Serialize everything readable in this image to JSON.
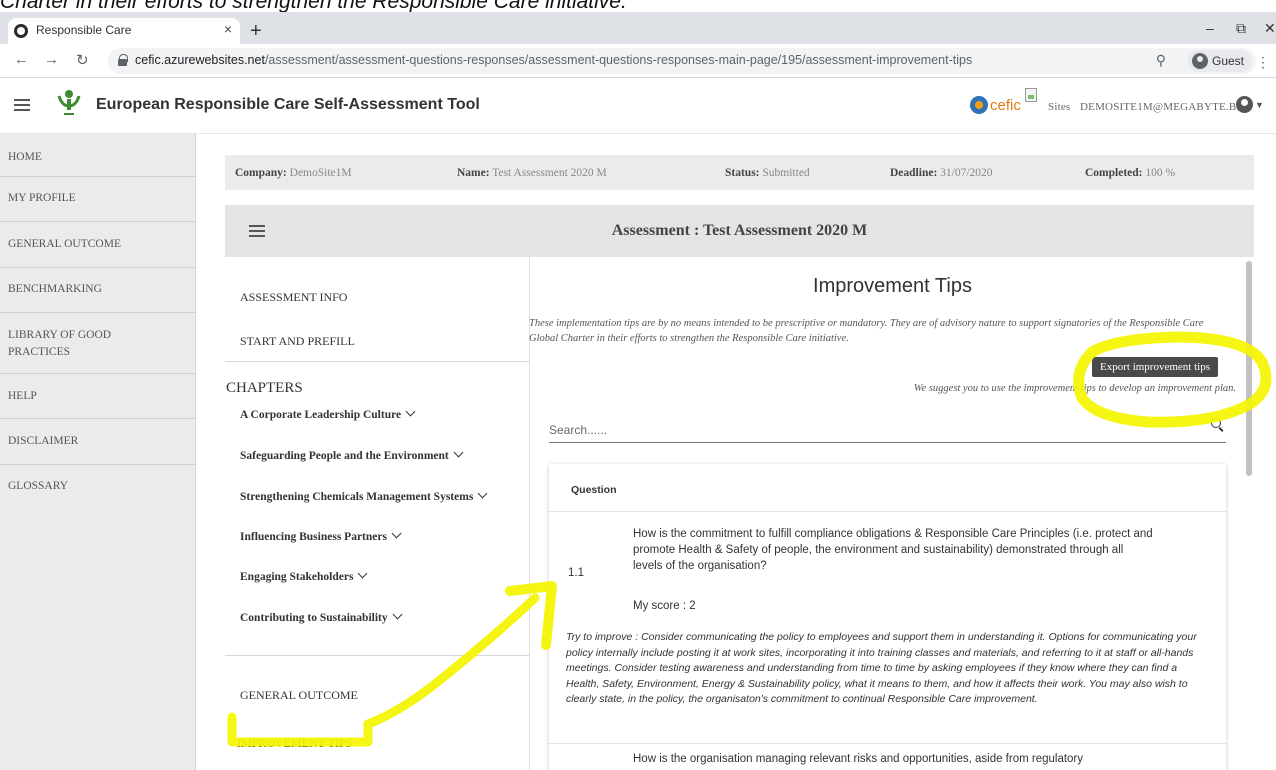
{
  "doc_caption": "Charter in their efforts to strengthen the Responsible Care initiative.",
  "browser": {
    "tab_title": "Responsible Care",
    "tab_close": "×",
    "new_tab": "+",
    "url_host": "cefic.azurewebsites.net",
    "url_path": "/assessment/assessment-questions-responses/assessment-questions-responses-main-page/195/assessment-improvement-tips",
    "profile_label": "Guest",
    "icons": [
      "back-icon",
      "forward-icon",
      "reload-icon",
      "lock-icon",
      "zoom-icon",
      "profile-icon",
      "menu-icon",
      "minimize-icon",
      "restore-icon",
      "close-icon"
    ]
  },
  "header": {
    "app_title": "European Responsible Care Self-Assessment Tool",
    "cefic_word": "cefic",
    "sites_link": "Sites",
    "user_email": "DEMOSITE1M@MEGABYTE.BE"
  },
  "sidebar": {
    "items": [
      {
        "label": "HOME"
      },
      {
        "label": "MY PROFILE"
      },
      {
        "label": "GENERAL OUTCOME"
      },
      {
        "label": "BENCHMARKING"
      },
      {
        "label": "LIBRARY OF GOOD PRACTICES"
      },
      {
        "label": "HELP"
      },
      {
        "label": "DISCLAIMER"
      },
      {
        "label": "GLOSSARY"
      }
    ]
  },
  "info": {
    "company_label": "Company:",
    "company_value": "DemoSite1M",
    "name_label": "Name:",
    "name_value": "Test Assessment 2020 M",
    "status_label": "Status:",
    "status_value": "Submitted",
    "deadline_label": "Deadline:",
    "deadline_value": "31/07/2020",
    "completed_label": "Completed:",
    "completed_value": "100 %"
  },
  "assessment": {
    "title": "Assessment : Test Assessment 2020 M"
  },
  "left_nav": {
    "assessment_info": "ASSESSMENT INFO",
    "start_prefill": "START AND PREFILL",
    "chapters_heading": "CHAPTERS",
    "chapters": [
      "A Corporate Leadership Culture",
      "Safeguarding People and the Environment",
      "Strengthening Chemicals Management Systems",
      "Influencing Business Partners",
      "Engaging Stakeholders",
      "Contributing to Sustainability"
    ],
    "general_outcome": "GENERAL OUTCOME",
    "improvement_tips": "IMPROVEMENT TIPS"
  },
  "main": {
    "heading": "Improvement Tips",
    "intro": "These implementation tips are by no means intended to be prescriptive or mandatory. They are of advisory nature to support signatories of the Responsible Care Global Charter in their efforts to strengthen the Responsible Care initiative.",
    "export_button": "Export improvement tips",
    "suggest": "We suggest you to use the improvement tips to develop an improvement plan.",
    "search_placeholder": "Search......",
    "table_header": "Question",
    "questions": [
      {
        "number": "1.1",
        "text": "How is the commitment to fulfill compliance obligations & Responsible Care Principles (i.e. protect and promote Health & Safety of people, the environment and sustainability) demonstrated through all levels of the organisation?",
        "score": "My score : 2",
        "tip": "Try to improve : Consider communicating the policy to employees and support them in understanding it. Options for communicating your policy internally include posting it at work sites, incorporating it into training classes and materials, and referring to it at staff or all-hands meetings. Consider testing awareness and understanding from time to time by asking employees if they know where they can find a Health, Safety, Environment, Energy & Sustainability policy, what it means to them, and how it affects their work. You may also wish to clearly state, in the policy, the organisaton's commitment to continual Responsible Care improvement."
      },
      {
        "text": "How is the organisation managing relevant risks and opportunities, aside from regulatory"
      }
    ]
  },
  "colors": {
    "annotation": "#f5f500",
    "sidebar_bg": "#ebebeb",
    "button_dark": "#4a4a4a",
    "cefic_orange": "#e07a10",
    "cefic_blue": "#2f72b8"
  }
}
